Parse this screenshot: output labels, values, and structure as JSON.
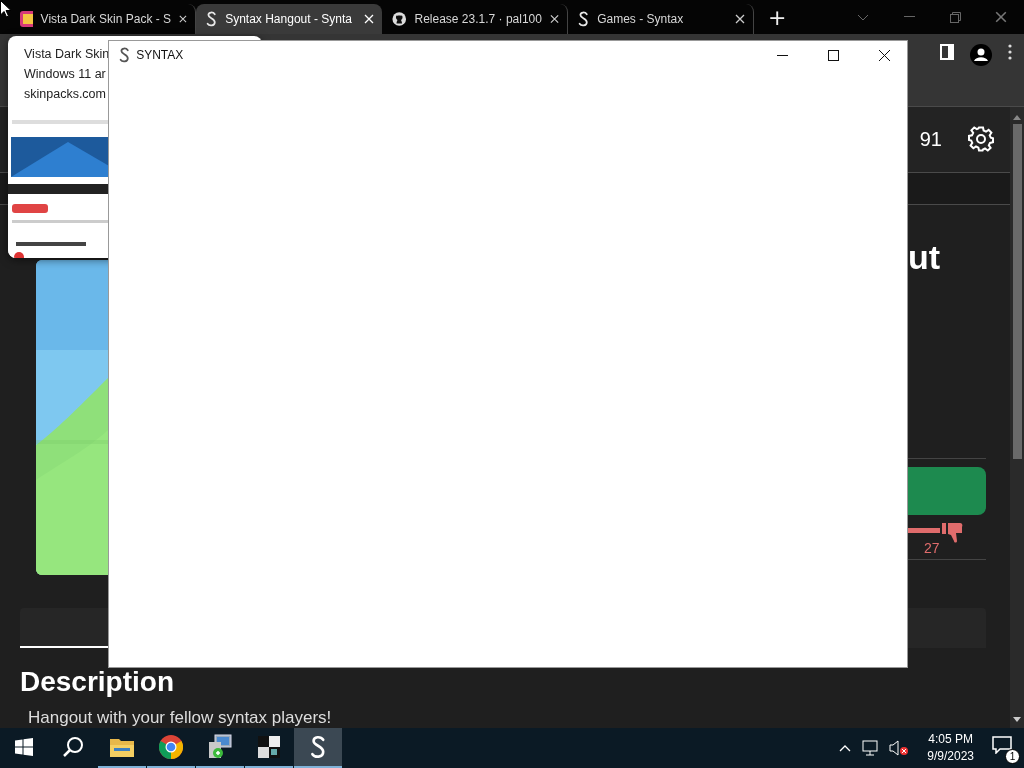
{
  "browser": {
    "tabs": [
      {
        "title": "Vista Dark Skin Pack - S",
        "kind": "skinpack",
        "selected": false
      },
      {
        "title": "Syntax Hangout - Synta",
        "kind": "syntax",
        "selected": true
      },
      {
        "title": "Release 23.1.7 · pal100",
        "kind": "github",
        "selected": false
      },
      {
        "title": "Games - Syntax",
        "kind": "syntax",
        "selected": false
      }
    ],
    "new_tab": "+"
  },
  "tab_preview": {
    "title_lines": [
      "Vista Dark Skin",
      "Windows 11 ar"
    ],
    "site": "skinpacks.com"
  },
  "page": {
    "count": "91",
    "title_fragment": "ut",
    "dislikes": "27",
    "heading": "Description",
    "description": "Hangout with your fellow syntax players!"
  },
  "app_window": {
    "title": "SYNTAX"
  },
  "taskbar": {
    "apps": [
      {
        "kind": "start",
        "running": false,
        "selected": false
      },
      {
        "kind": "search",
        "running": false,
        "selected": false
      },
      {
        "kind": "explorer",
        "running": true,
        "selected": false
      },
      {
        "kind": "chrome",
        "running": true,
        "selected": false
      },
      {
        "kind": "installer",
        "running": true,
        "selected": false
      },
      {
        "kind": "checker",
        "running": true,
        "selected": false
      },
      {
        "kind": "syntax",
        "running": true,
        "selected": true
      }
    ],
    "time": "4:05 PM",
    "date": "9/9/2023",
    "notifications": "1"
  }
}
